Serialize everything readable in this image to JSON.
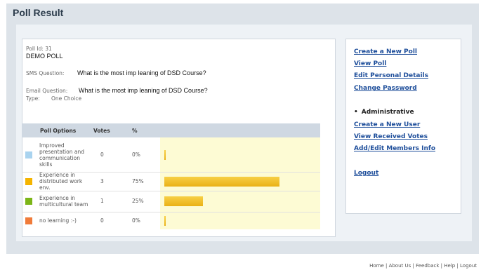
{
  "page": {
    "title": "Poll Result"
  },
  "poll": {
    "id_text": "Poll Id: 31",
    "name": "DEMO POLL",
    "sms_label": "SMS Question:",
    "sms_question": "What is the most imp leaning of DSD Course?",
    "email_label": "Email Question:",
    "email_question": "What is the most imp leaning of DSD Course?",
    "type_label": "Type:",
    "type_value": "One Choice"
  },
  "table": {
    "headers": [
      "Poll Options",
      "Votes",
      "%"
    ],
    "rows": [
      {
        "option": "Improved presentation and communication skills",
        "votes": "0",
        "percent": "0%",
        "fraction": 0.0,
        "color": "#a9d3ef"
      },
      {
        "option": "Experience in distributed work env.",
        "votes": "3",
        "percent": "75%",
        "fraction": 0.75,
        "color": "#f4b400"
      },
      {
        "option": "Experience in multicultural team",
        "votes": "1",
        "percent": "25%",
        "fraction": 0.25,
        "color": "#7cb518"
      },
      {
        "option": "no learning :-)",
        "votes": "0",
        "percent": "0%",
        "fraction": 0.0,
        "color": "#f07b3a"
      }
    ]
  },
  "sidebar": {
    "links": [
      "Create a New Poll",
      "View Poll",
      "Edit Personal Details",
      "Change Password"
    ],
    "section_title": "Administrative",
    "admin_links": [
      "Create a New User",
      "View Received Votes",
      "Add/Edit Members Info"
    ],
    "logout": "Logout"
  },
  "footer": {
    "links": [
      "Home",
      "About Us",
      "Feedback",
      "Help",
      "Logout"
    ]
  }
}
